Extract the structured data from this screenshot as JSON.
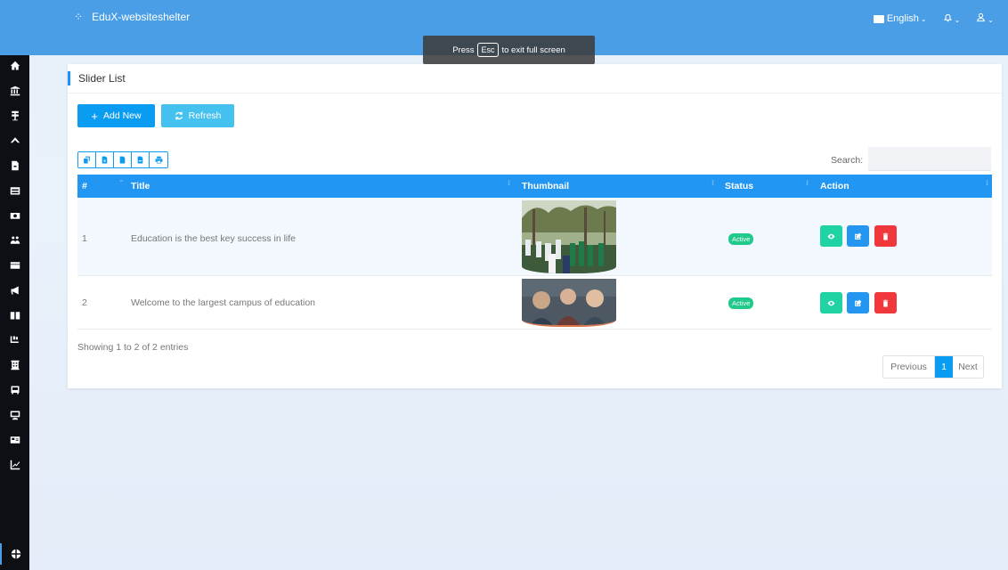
{
  "app": {
    "brand_title": "EduX-websiteshelter",
    "language": "English"
  },
  "fullscreen_toast": {
    "press": "Press",
    "key": "Esc",
    "message": "to exit full screen"
  },
  "sidebar": {
    "items": [
      {
        "icon": "home-icon"
      },
      {
        "icon": "institution-icon"
      },
      {
        "icon": "award-icon"
      },
      {
        "icon": "graduation-cap-icon"
      },
      {
        "icon": "file-icon"
      },
      {
        "icon": "calendar-icon"
      },
      {
        "icon": "camera-icon"
      },
      {
        "icon": "users-icon"
      },
      {
        "icon": "credit-card-icon"
      },
      {
        "icon": "bullhorn-icon"
      },
      {
        "icon": "book-icon"
      },
      {
        "icon": "dolly-icon"
      },
      {
        "icon": "building-icon"
      },
      {
        "icon": "bus-icon"
      },
      {
        "icon": "desktop-icon"
      },
      {
        "icon": "id-card-icon"
      },
      {
        "icon": "chart-line-icon"
      },
      {
        "icon": "globe-icon",
        "active": true
      }
    ]
  },
  "page": {
    "title": "Slider List",
    "add_label": "Add New",
    "refresh_label": "Refresh",
    "search_label": "Search:",
    "search_value": ""
  },
  "table": {
    "columns": [
      "#",
      "Title",
      "Thumbnail",
      "Status",
      "Action"
    ],
    "rows": [
      {
        "num": "1",
        "title": "Education is the best key success in life",
        "status": "Active"
      },
      {
        "num": "2",
        "title": "Welcome to the largest campus of education",
        "status": "Active"
      }
    ],
    "info": "Showing 1 to 2 of 2 entries",
    "pager": {
      "prev": "Previous",
      "current": "1",
      "next": "Next"
    }
  },
  "colors": {
    "topbar": "#4a9ee6",
    "primary": "#0a9cf1",
    "table_head": "#2196f3",
    "status_active": "#21c98b",
    "view": "#1fd3a2",
    "edit": "#2496f0",
    "delete": "#f0373b"
  }
}
